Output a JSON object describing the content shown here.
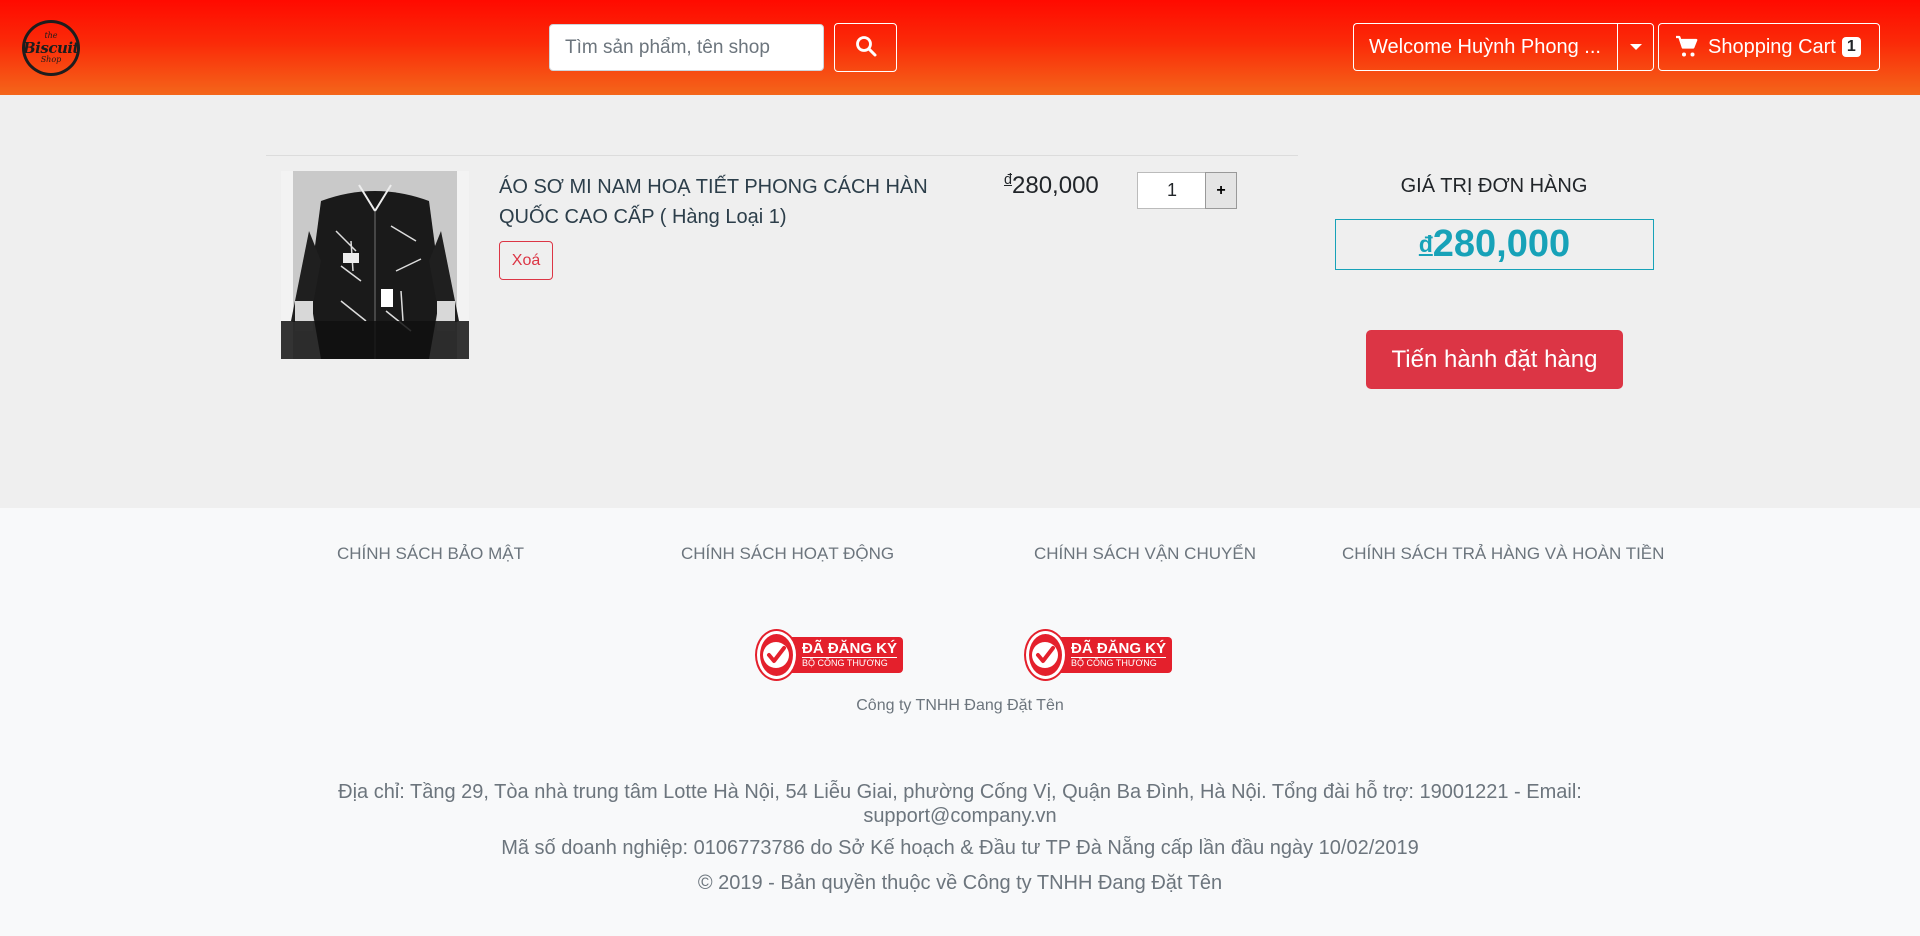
{
  "header": {
    "logo_small": "the",
    "logo_main": "Biscuit",
    "logo_sub": "Shop",
    "search_placeholder": "Tìm sản phẩm, tên shop",
    "welcome_label": "Welcome Huỳnh Phong ...",
    "cart_label": "Shopping Cart",
    "cart_count": "1"
  },
  "cart": {
    "items": [
      {
        "title": "ÁO SƠ MI NAM HOẠ TIẾT PHONG CÁCH HÀN QUỐC CAO CẤP ( Hàng Loại 1)",
        "remove_label": "Xoá",
        "currency": "đ",
        "price": "280,000",
        "quantity": "1",
        "plus_label": "+"
      }
    ],
    "summary": {
      "label": "GIÁ TRỊ ĐƠN HÀNG",
      "currency": "đ",
      "total": "280,000",
      "checkout_label": "Tiến hành đặt hàng"
    }
  },
  "footer": {
    "policies": [
      "CHÍNH SÁCH BẢO MẬT",
      "CHÍNH SÁCH HOẠT ĐỘNG",
      "CHÍNH SÁCH VẬN CHUYỂN",
      "CHÍNH SÁCH TRẢ HÀNG VÀ HOÀN TIỀN"
    ],
    "badge_main": "ĐÃ ĐĂNG KÝ",
    "badge_sub": "BỘ CÔNG THƯƠNG",
    "company_small": "Công ty TNHH Đang Đặt Tên",
    "address": "Địa chỉ: Tầng 29, Tòa nhà trung tâm Lotte Hà Nội, 54 Liễu Giai, phường Cống Vị, Quận Ba Đình, Hà Nội. Tổng đài hỗ trợ: 19001221 - Email: support@company.vn",
    "tax_id": "Mã số doanh nghiệp: 0106773786 do Sở Kế hoạch & Đầu tư TP Đà Nẵng cấp lần đầu ngày 10/02/2019",
    "copyright": "© 2019 - Bản quyền thuộc về Công ty TNHH Đang Đặt Tên"
  },
  "colors": {
    "header_top": "#ff0a00",
    "header_bottom": "#f4661a",
    "danger": "#dc3545",
    "info": "#17a2b8"
  },
  "icons": [
    "logo-icon",
    "search-icon",
    "caret-down-icon",
    "cart-icon",
    "check-icon"
  ]
}
